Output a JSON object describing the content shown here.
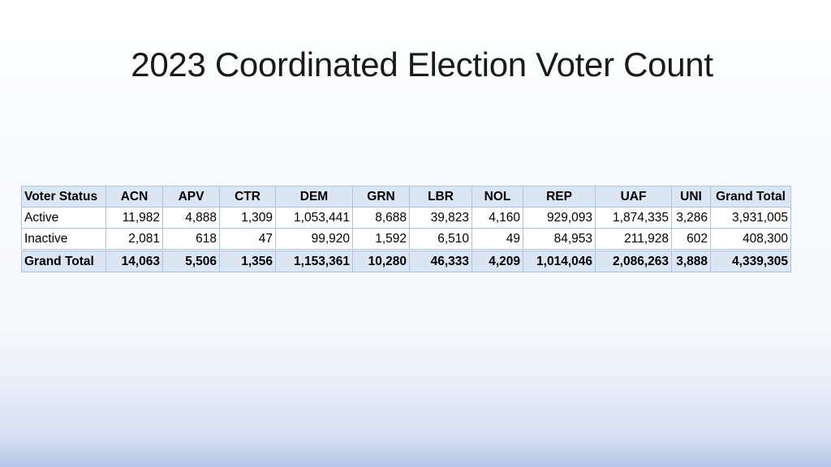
{
  "slide": {
    "title": "2023 Coordinated Election Voter Count"
  },
  "table": {
    "columns": [
      "Voter Status",
      "ACN",
      "APV",
      "CTR",
      "DEM",
      "GRN",
      "LBR",
      "NOL",
      "REP",
      "UAF",
      "UNI",
      "Grand Total"
    ],
    "rows": [
      [
        "Active",
        "11,982",
        "4,888",
        "1,309",
        "1,053,441",
        "8,688",
        "39,823",
        "4,160",
        "929,093",
        "1,874,335",
        "3,286",
        "3,931,005"
      ],
      [
        "Inactive",
        "2,081",
        "618",
        "47",
        "99,920",
        "1,592",
        "6,510",
        "49",
        "84,953",
        "211,928",
        "602",
        "408,300"
      ]
    ],
    "total_row": [
      "Grand Total",
      "14,063",
      "5,506",
      "1,356",
      "1,153,361",
      "10,280",
      "46,333",
      "4,209",
      "1,014,046",
      "2,086,263",
      "3,888",
      "4,339,305"
    ]
  },
  "colors": {
    "header_fill": "#dbe6f5",
    "border": "#a9c4e8",
    "title_text": "#1a1a1a"
  }
}
